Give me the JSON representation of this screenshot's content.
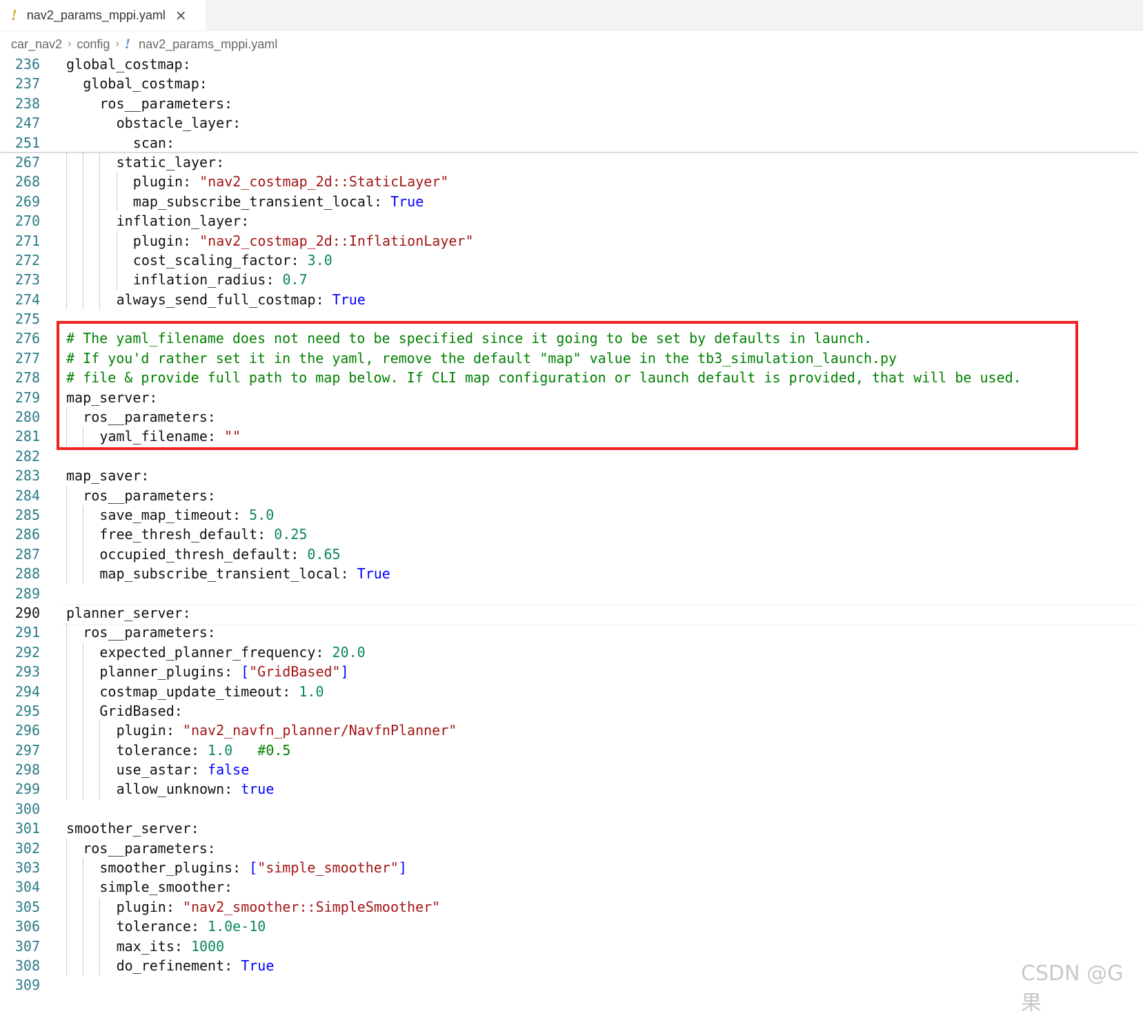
{
  "tab": {
    "title": "nav2_params_mppi.yaml",
    "modified_icon": "!",
    "close_icon": "×"
  },
  "breadcrumb": {
    "items": [
      "car_nav2",
      "config"
    ],
    "file": "nav2_params_mppi.yaml",
    "separator": "›",
    "file_icon": "!"
  },
  "lines": [
    {
      "no": "236",
      "indent": 0,
      "tokens": [
        [
          "k",
          "global_costmap:"
        ]
      ]
    },
    {
      "no": "237",
      "indent": 1,
      "tokens": [
        [
          "k",
          "global_costmap:"
        ]
      ]
    },
    {
      "no": "238",
      "indent": 2,
      "tokens": [
        [
          "k",
          "ros__parameters:"
        ]
      ]
    },
    {
      "no": "247",
      "indent": 3,
      "tokens": [
        [
          "k",
          "obstacle_layer:"
        ]
      ]
    },
    {
      "no": "251",
      "indent": 4,
      "tokens": [
        [
          "k",
          "scan:"
        ]
      ]
    },
    {
      "no": "267",
      "indent": 3,
      "tokens": [
        [
          "k",
          "static_layer:"
        ]
      ]
    },
    {
      "no": "268",
      "indent": 4,
      "tokens": [
        [
          "k",
          "plugin: "
        ],
        [
          "s",
          "\"nav2_costmap_2d::StaticLayer\""
        ]
      ]
    },
    {
      "no": "269",
      "indent": 4,
      "tokens": [
        [
          "k",
          "map_subscribe_transient_local: "
        ],
        [
          "b",
          "True"
        ]
      ]
    },
    {
      "no": "270",
      "indent": 3,
      "tokens": [
        [
          "k",
          "inflation_layer:"
        ]
      ]
    },
    {
      "no": "271",
      "indent": 4,
      "tokens": [
        [
          "k",
          "plugin: "
        ],
        [
          "s",
          "\"nav2_costmap_2d::InflationLayer\""
        ]
      ]
    },
    {
      "no": "272",
      "indent": 4,
      "tokens": [
        [
          "k",
          "cost_scaling_factor: "
        ],
        [
          "n",
          "3.0"
        ]
      ]
    },
    {
      "no": "273",
      "indent": 4,
      "tokens": [
        [
          "k",
          "inflation_radius: "
        ],
        [
          "n",
          "0.7"
        ]
      ]
    },
    {
      "no": "274",
      "indent": 3,
      "tokens": [
        [
          "k",
          "always_send_full_costmap: "
        ],
        [
          "b",
          "True"
        ]
      ]
    },
    {
      "no": "275",
      "indent": 0,
      "tokens": []
    },
    {
      "no": "276",
      "indent": 0,
      "tokens": [
        [
          "c",
          "# The yaml_filename does not need to be specified since it going to be set by defaults in launch."
        ]
      ]
    },
    {
      "no": "277",
      "indent": 0,
      "tokens": [
        [
          "c",
          "# If you'd rather set it in the yaml, remove the default \"map\" value in the tb3_simulation_launch.py"
        ]
      ]
    },
    {
      "no": "278",
      "indent": 0,
      "tokens": [
        [
          "c",
          "# file & provide full path to map below. If CLI map configuration or launch default is provided, that will be used."
        ]
      ]
    },
    {
      "no": "279",
      "indent": 0,
      "tokens": [
        [
          "k",
          "map_server:"
        ]
      ]
    },
    {
      "no": "280",
      "indent": 1,
      "tokens": [
        [
          "k",
          "ros__parameters:"
        ]
      ]
    },
    {
      "no": "281",
      "indent": 2,
      "tokens": [
        [
          "k",
          "yaml_filename: "
        ],
        [
          "s",
          "\"\""
        ]
      ]
    },
    {
      "no": "282",
      "indent": 0,
      "tokens": []
    },
    {
      "no": "283",
      "indent": 0,
      "tokens": [
        [
          "k",
          "map_saver:"
        ]
      ]
    },
    {
      "no": "284",
      "indent": 1,
      "tokens": [
        [
          "k",
          "ros__parameters:"
        ]
      ]
    },
    {
      "no": "285",
      "indent": 2,
      "tokens": [
        [
          "k",
          "save_map_timeout: "
        ],
        [
          "n",
          "5.0"
        ]
      ]
    },
    {
      "no": "286",
      "indent": 2,
      "tokens": [
        [
          "k",
          "free_thresh_default: "
        ],
        [
          "n",
          "0.25"
        ]
      ]
    },
    {
      "no": "287",
      "indent": 2,
      "tokens": [
        [
          "k",
          "occupied_thresh_default: "
        ],
        [
          "n",
          "0.65"
        ]
      ]
    },
    {
      "no": "288",
      "indent": 2,
      "tokens": [
        [
          "k",
          "map_subscribe_transient_local: "
        ],
        [
          "b",
          "True"
        ]
      ]
    },
    {
      "no": "289",
      "indent": 0,
      "tokens": []
    },
    {
      "no": "290",
      "indent": 0,
      "active": true,
      "tokens": [
        [
          "k",
          "planner_server:"
        ]
      ]
    },
    {
      "no": "291",
      "indent": 1,
      "tokens": [
        [
          "k",
          "ros__parameters:"
        ]
      ]
    },
    {
      "no": "292",
      "indent": 2,
      "tokens": [
        [
          "k",
          "expected_planner_frequency: "
        ],
        [
          "n",
          "20.0"
        ]
      ]
    },
    {
      "no": "293",
      "indent": 2,
      "tokens": [
        [
          "k",
          "planner_plugins: "
        ],
        [
          "b",
          "["
        ],
        [
          "s",
          "\"GridBased\""
        ],
        [
          "b",
          "]"
        ]
      ]
    },
    {
      "no": "294",
      "indent": 2,
      "tokens": [
        [
          "k",
          "costmap_update_timeout: "
        ],
        [
          "n",
          "1.0"
        ]
      ]
    },
    {
      "no": "295",
      "indent": 2,
      "tokens": [
        [
          "k",
          "GridBased:"
        ]
      ]
    },
    {
      "no": "296",
      "indent": 3,
      "tokens": [
        [
          "k",
          "plugin: "
        ],
        [
          "s",
          "\"nav2_navfn_planner/NavfnPlanner\""
        ]
      ]
    },
    {
      "no": "297",
      "indent": 3,
      "tokens": [
        [
          "k",
          "tolerance: "
        ],
        [
          "n",
          "1.0"
        ],
        [
          "k",
          "   "
        ],
        [
          "c",
          "#0.5"
        ]
      ]
    },
    {
      "no": "298",
      "indent": 3,
      "tokens": [
        [
          "k",
          "use_astar: "
        ],
        [
          "b",
          "false"
        ]
      ]
    },
    {
      "no": "299",
      "indent": 3,
      "tokens": [
        [
          "k",
          "allow_unknown: "
        ],
        [
          "b",
          "true"
        ]
      ]
    },
    {
      "no": "300",
      "indent": 0,
      "tokens": []
    },
    {
      "no": "301",
      "indent": 0,
      "tokens": [
        [
          "k",
          "smoother_server:"
        ]
      ]
    },
    {
      "no": "302",
      "indent": 1,
      "tokens": [
        [
          "k",
          "ros__parameters:"
        ]
      ]
    },
    {
      "no": "303",
      "indent": 2,
      "tokens": [
        [
          "k",
          "smoother_plugins: "
        ],
        [
          "b",
          "["
        ],
        [
          "s",
          "\"simple_smoother\""
        ],
        [
          "b",
          "]"
        ]
      ]
    },
    {
      "no": "304",
      "indent": 2,
      "tokens": [
        [
          "k",
          "simple_smoother:"
        ]
      ]
    },
    {
      "no": "305",
      "indent": 3,
      "tokens": [
        [
          "k",
          "plugin: "
        ],
        [
          "s",
          "\"nav2_smoother::SimpleSmoother\""
        ]
      ]
    },
    {
      "no": "306",
      "indent": 3,
      "tokens": [
        [
          "k",
          "tolerance: "
        ],
        [
          "n",
          "1.0e-10"
        ]
      ]
    },
    {
      "no": "307",
      "indent": 3,
      "tokens": [
        [
          "k",
          "max_its: "
        ],
        [
          "n",
          "1000"
        ]
      ]
    },
    {
      "no": "308",
      "indent": 3,
      "tokens": [
        [
          "k",
          "do_refinement: "
        ],
        [
          "b",
          "True"
        ]
      ]
    },
    {
      "no": "309",
      "indent": 0,
      "tokens": []
    }
  ],
  "watermark": "CSDN @G果",
  "colors": {
    "key": "#111111",
    "string": "#a31515",
    "number": "#098658",
    "keyword": "#0000ff",
    "comment": "#008000",
    "line_number": "#2a7a85",
    "highlight_border": "#f21f1f"
  }
}
